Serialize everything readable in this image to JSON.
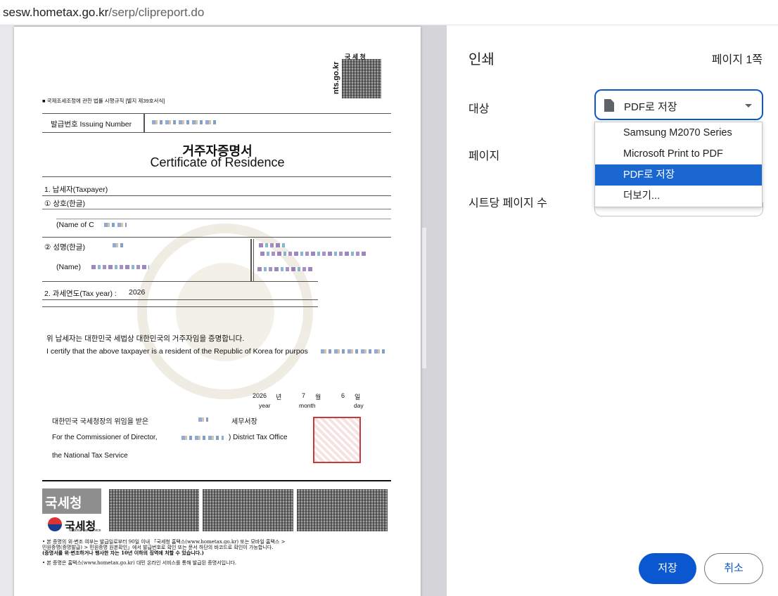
{
  "browser": {
    "url_host": "sesw.hometax.go.kr",
    "url_path": "/serp/clipreport.do"
  },
  "document": {
    "agency": "국 세 청",
    "site": "nts.go.kr",
    "form_ref": "■ 국제조세조정에 관한 법률 시행규칙 [별지 제39호서식]",
    "issuing_number_label": "발급번호 Issuing Number",
    "title_ko": "거주자증명서",
    "title_en": "Certificate of Residence",
    "taxpayer_label": "1. 납세자(Taxpayer)",
    "company_ko_label": "① 상호(한글)",
    "company_en_label": "(Name of C",
    "person_ko_label": "② 성명(한글)",
    "person_en_label": "(Name)",
    "tax_year_label": "2. 과세연도(Tax year) :",
    "tax_year_value": "2026",
    "certify_ko": "위 납세자는 대한민국 세법상 대한민국의 거주자임을 증명합니다.",
    "certify_en": "I certify that the above taxpayer is a resident of the Republic of Korea for purpos",
    "date_year": "2026",
    "date_year_ko": "년",
    "date_year_en": "year",
    "date_month": "7",
    "date_month_ko": "월",
    "date_month_en": "month",
    "date_day": "6",
    "date_day_ko": "일",
    "date_day_en": "day",
    "delegation_ko": "대한민국 국세청장의 위임을 받은",
    "office_suffix_ko": "세무서장",
    "commissioner_en": "For the Commissioner of  Director,",
    "district_office_en": ") District Tax Office",
    "nts_en": "the National Tax Service",
    "logo_box_text": "국세청",
    "logo_text": "국세청",
    "logo_sub": "National Tax Service",
    "note1": "• 본 증명의 위·변조 여부는 발급일로부터 90일 이내 「국세청 홈택스(www.hometax.go.kr) 또는 모바일 홈택스 >",
    "note2": "민원증명(증명발급) > 민원증명 원본확인」에서 발급번호로 확인 또는 문서 하단의 바코드로 확인이 가능합니다.",
    "note3": "(증명서를 위·변조하거나 행사한 자는 10년 이하의 징역에 처할 수 있습니다.)",
    "note4": "• 본 증명은 홈택스(www.hometax.go.kr) 대민 온라인 서비스를 통해 발급된 증명서입니다."
  },
  "print_dialog": {
    "title": "인쇄",
    "page_count": "페이지 1쪽",
    "destination_label": "대상",
    "pages_label": "페이지",
    "pages_per_sheet_label": "시트당 페이지 수",
    "destination_value": "PDF로 저장",
    "destination_options": [
      "Samsung M2070 Series",
      "Microsoft Print to PDF",
      "PDF로 저장",
      "더보기..."
    ],
    "save_button": "저장",
    "cancel_button": "취소"
  },
  "colors": {
    "accent": "#0b57d0",
    "menu_highlight": "#1a67d2",
    "stamp": "#c83a3a"
  }
}
